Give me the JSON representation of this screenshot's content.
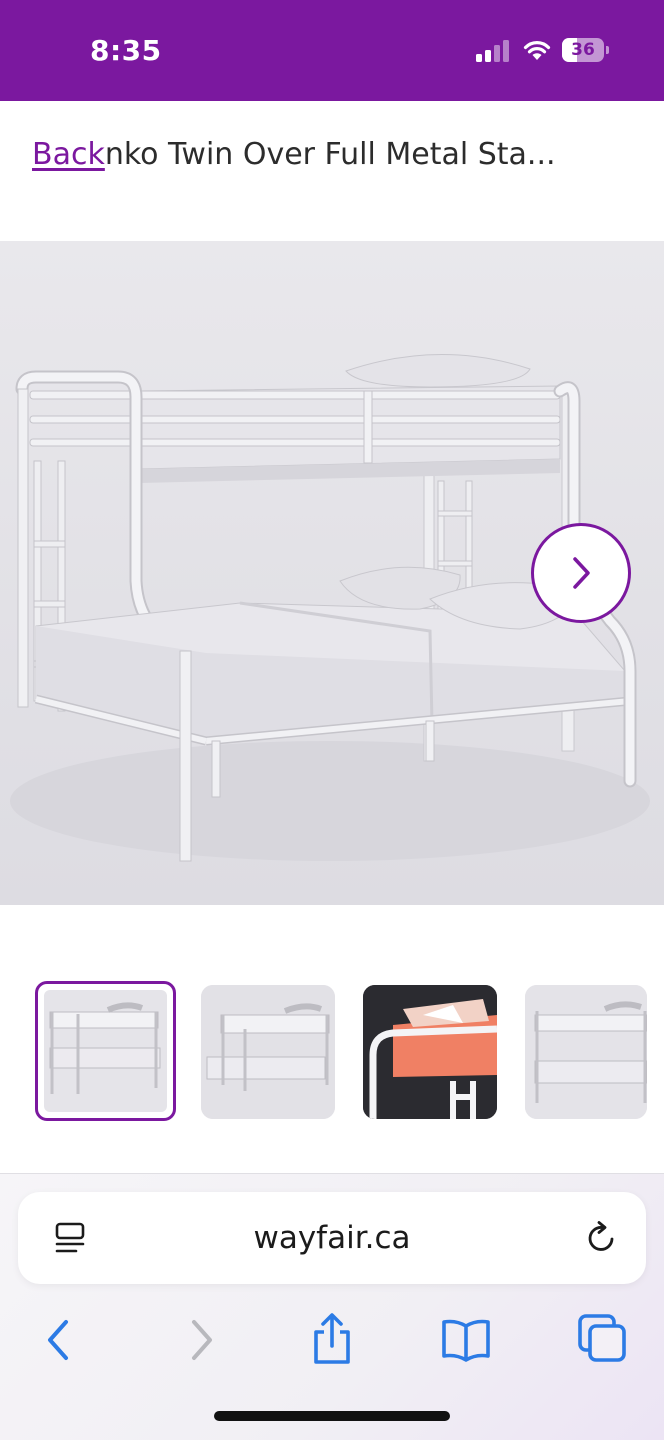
{
  "status_bar": {
    "time": "8:35",
    "battery": "36"
  },
  "header": {
    "back_label": "Back",
    "title": "nko Twin Over Full Metal Sta..."
  },
  "gallery": {
    "thumbnails": [
      "bunk bed white front view",
      "bunk bed white angled view",
      "bunk bed with orange bedding",
      "bunk bed side view"
    ],
    "selected_index": 0
  },
  "browser": {
    "url": "wayfair.ca",
    "icons": [
      "reader-icon",
      "reload-icon",
      "back-arrow-icon",
      "forward-arrow-icon",
      "share-icon",
      "bookmarks-icon",
      "tabs-icon"
    ]
  },
  "colors": {
    "brand": "#7b189f",
    "ios_blue": "#2c7be5"
  }
}
